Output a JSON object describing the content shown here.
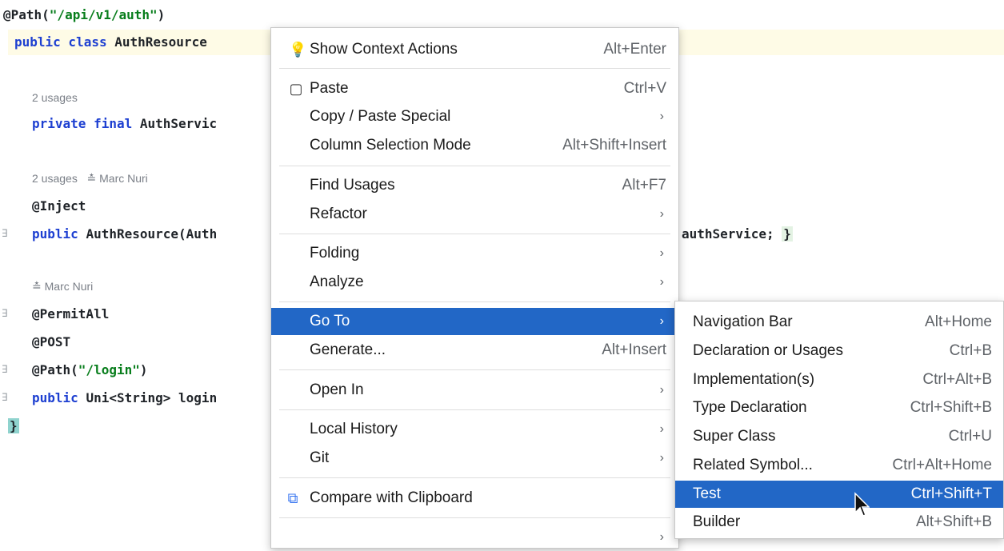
{
  "editor": {
    "lines": {
      "path_annotation": "@Path(",
      "path_value": "\"/api/v1/auth\"",
      "path_close": ")",
      "class_decl_kw": "public class ",
      "class_name": "AuthResource",
      "usages_1": "2 usages",
      "field_kw": "private final ",
      "field_type": "AuthServic",
      "usages_2": "2 usages",
      "author_2": "Marc Nuri",
      "inject": "@Inject",
      "ctor_kw": "public ",
      "ctor_sig": "AuthResource(Auth",
      "ctor_tail": "authService; ",
      "ctor_brace": "}",
      "author_3": "Marc Nuri",
      "permit_all": "@PermitAll",
      "post": "@POST",
      "login_path_open": "@Path(",
      "login_path_value": "\"/login\"",
      "login_path_close": ")",
      "login_kw": "public ",
      "login_sig": "Uni<String> login",
      "class_close": "}"
    }
  },
  "context_menu": {
    "items": [
      {
        "label": "Show Context Actions",
        "shortcut": "Alt+Enter",
        "icon": "lightbulb-icon"
      },
      {
        "label": "Paste",
        "shortcut": "Ctrl+V",
        "icon": "clipboard-icon"
      },
      {
        "label": "Copy / Paste Special",
        "shortcut": "",
        "submenu": true
      },
      {
        "label": "Column Selection Mode",
        "shortcut": "Alt+Shift+Insert"
      },
      {
        "label": "Find Usages",
        "shortcut": "Alt+F7"
      },
      {
        "label": "Refactor",
        "submenu": true
      },
      {
        "label": "Folding",
        "submenu": true
      },
      {
        "label": "Analyze",
        "submenu": true
      },
      {
        "label": "Go To",
        "submenu": true,
        "selected": true
      },
      {
        "label": "Generate...",
        "shortcut": "Alt+Insert"
      },
      {
        "label": "Open In",
        "submenu": true
      },
      {
        "label": "Local History",
        "submenu": true
      },
      {
        "label": "Git",
        "submenu": true
      },
      {
        "label": "Compare with Clipboard",
        "icon": "compare-clipboard-icon"
      }
    ],
    "arrow_glyph": "›"
  },
  "goto_submenu": {
    "items": [
      {
        "label": "Navigation Bar",
        "shortcut": "Alt+Home"
      },
      {
        "label": "Declaration or Usages",
        "shortcut": "Ctrl+B"
      },
      {
        "label": "Implementation(s)",
        "shortcut": "Ctrl+Alt+B"
      },
      {
        "label": "Type Declaration",
        "shortcut": "Ctrl+Shift+B"
      },
      {
        "label": "Super Class",
        "shortcut": "Ctrl+U"
      },
      {
        "label": "Related Symbol...",
        "shortcut": "Ctrl+Alt+Home"
      },
      {
        "label": "Test",
        "shortcut": "Ctrl+Shift+T",
        "selected": true
      },
      {
        "label": "Builder",
        "shortcut": "Alt+Shift+B"
      }
    ]
  },
  "colors": {
    "selection": "#2267c6",
    "string": "#077d1b",
    "keyword": "#1d3fd1"
  }
}
